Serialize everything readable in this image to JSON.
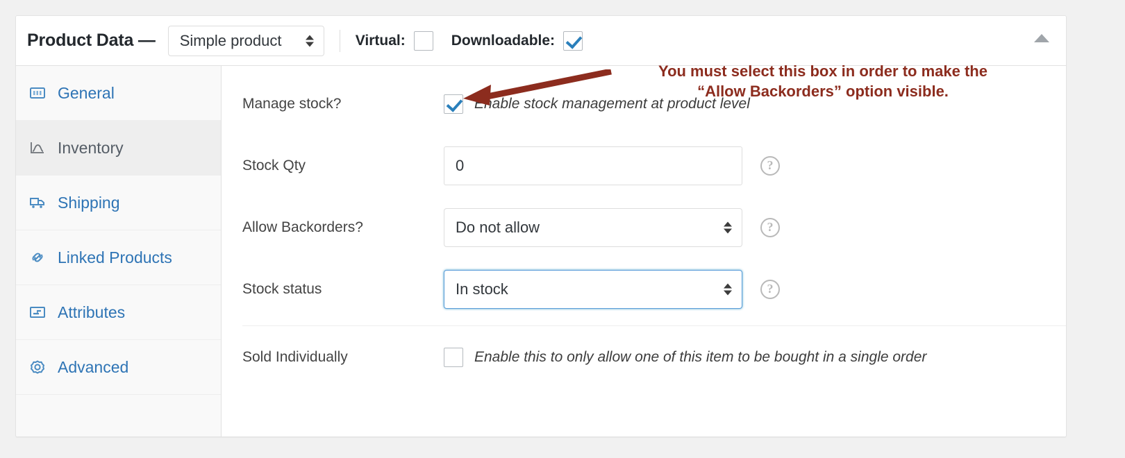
{
  "header": {
    "title": "Product Data —",
    "product_type": {
      "value": "Simple product",
      "icon": "chevron-updown-icon"
    },
    "virtual": {
      "label": "Virtual:",
      "checked": false
    },
    "downloadable": {
      "label": "Downloadable:",
      "checked": true
    },
    "collapse_icon": "triangle-up-icon"
  },
  "tabs": [
    {
      "label": "General",
      "icon": "general-icon",
      "active": false
    },
    {
      "label": "Inventory",
      "icon": "inventory-icon",
      "active": true
    },
    {
      "label": "Shipping",
      "icon": "shipping-truck-icon",
      "active": false
    },
    {
      "label": "Linked Products",
      "icon": "link-icon",
      "active": false
    },
    {
      "label": "Attributes",
      "icon": "attributes-icon",
      "active": false
    },
    {
      "label": "Advanced",
      "icon": "gear-icon",
      "active": false
    }
  ],
  "fields": {
    "manage_stock": {
      "label": "Manage stock?",
      "checked": true,
      "description": "Enable stock management at product level"
    },
    "stock_qty": {
      "label": "Stock Qty",
      "value": "0",
      "help_icon": "question-mark-icon"
    },
    "allow_backorders": {
      "label": "Allow Backorders?",
      "value": "Do not allow",
      "help_icon": "question-mark-icon"
    },
    "stock_status": {
      "label": "Stock status",
      "value": "In stock",
      "help_icon": "question-mark-icon",
      "focused": true
    },
    "sold_individually": {
      "label": "Sold Individually",
      "checked": false,
      "description": "Enable this to only allow one of this item to be bought in a single order"
    }
  },
  "annotation": {
    "line1": "You must select this box in order to make the",
    "line2": "“Allow Backorders” option visible.",
    "color": "#8c2c1e",
    "arrow_icon": "arrow-pointing-left-icon"
  },
  "colors": {
    "page_background": "#f1f1f1",
    "panel_background": "#ffffff",
    "link_blue": "#2e74b5",
    "checkbox_blue": "#2a7fbb",
    "focus_blue": "#5b9dd9",
    "annotation_red": "#8c2c1e"
  }
}
